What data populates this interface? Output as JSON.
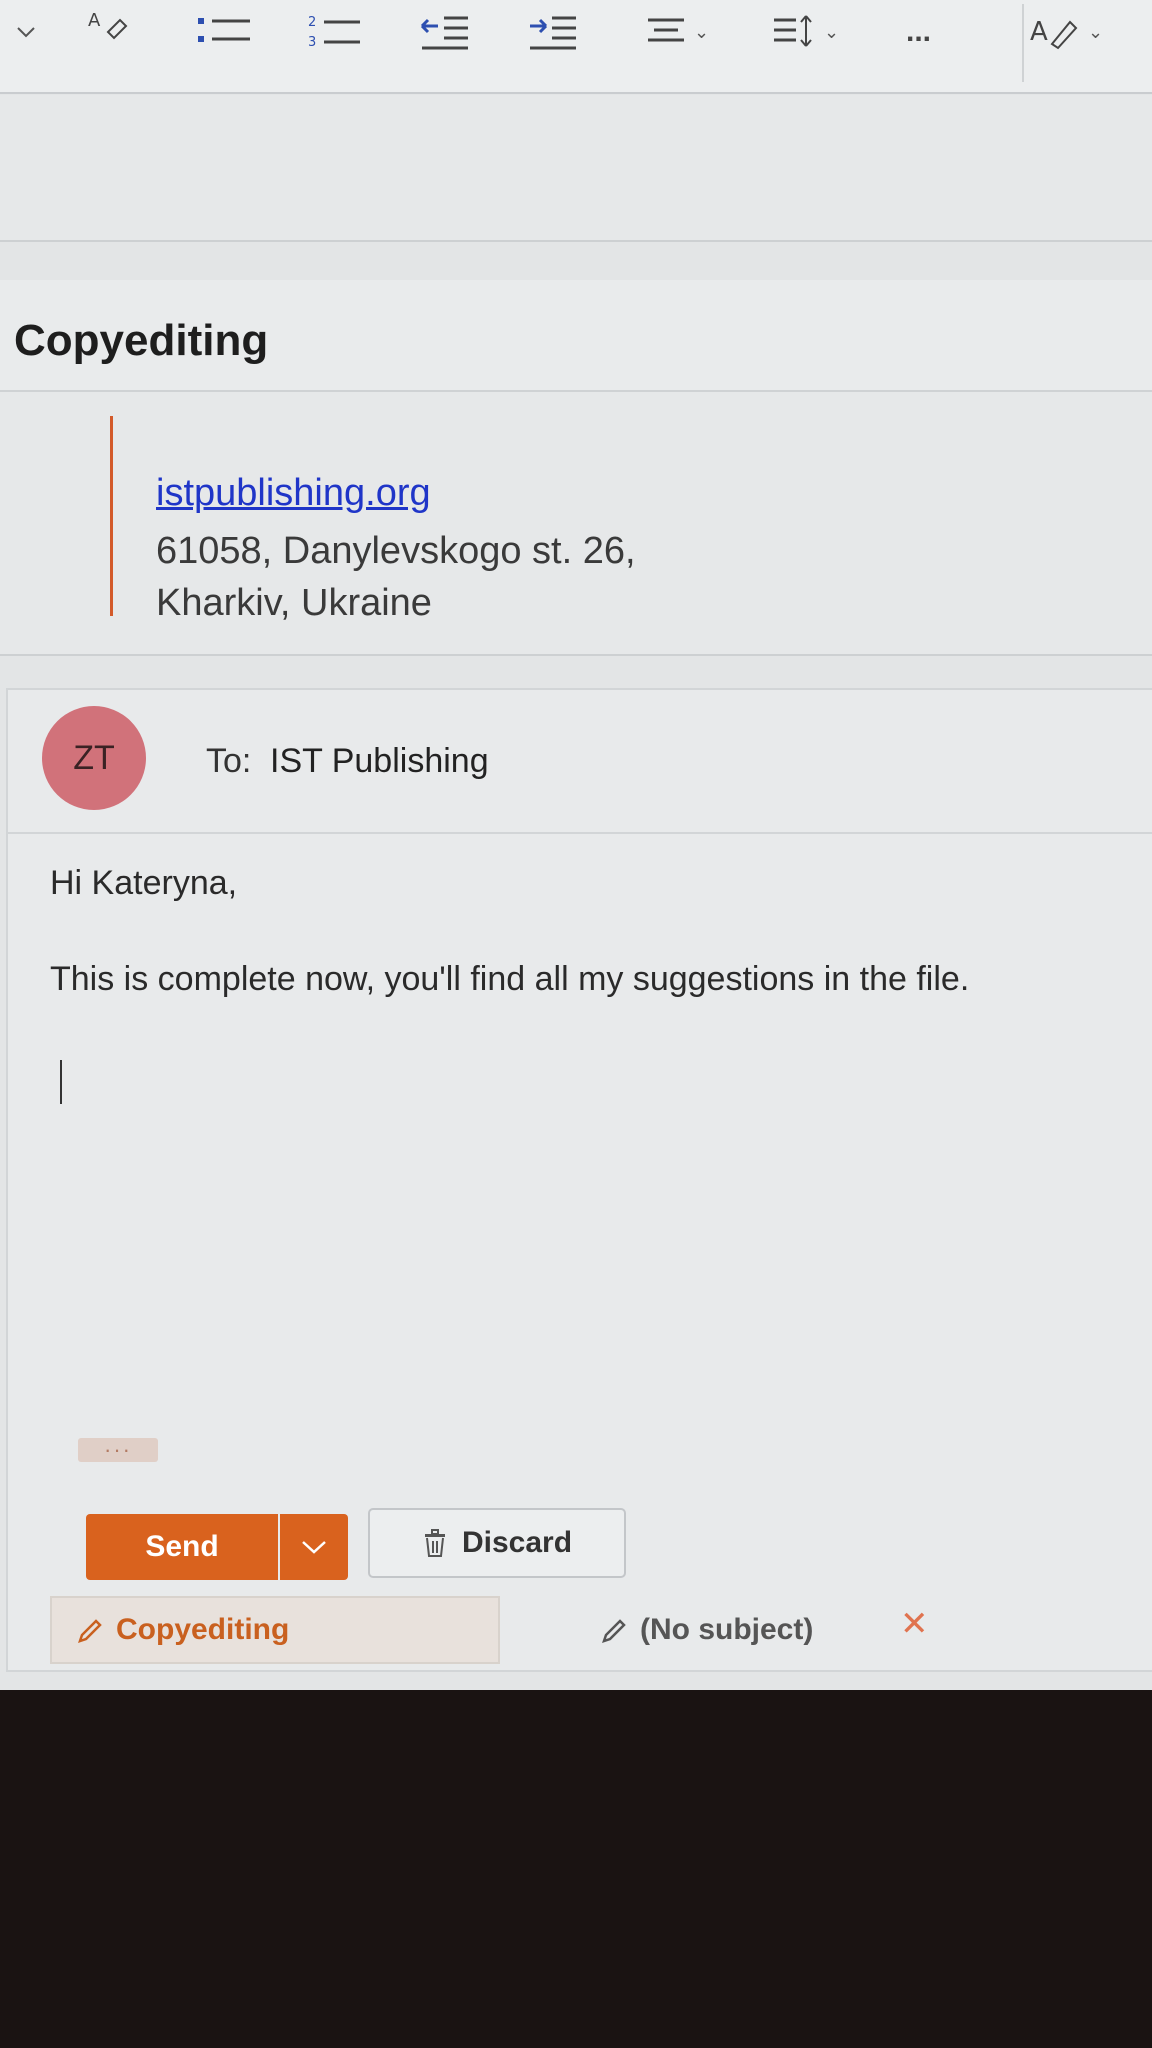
{
  "colors": {
    "accent": "#d9621e",
    "link": "#1f35c8",
    "avatar": "#d1727a"
  },
  "ribbon": {
    "icons": [
      "format-painter-icon",
      "bullet-list-icon",
      "numbered-list-icon",
      "decrease-indent-icon",
      "increase-indent-icon",
      "align-icon",
      "line-spacing-icon",
      "more-options-icon",
      "editor-icon"
    ],
    "more_label": "..."
  },
  "subject": {
    "title": "Copyediting"
  },
  "signature": {
    "link": "istpublishing.org",
    "address_line1": "61058, Danylevskogo st. 26,",
    "address_line2": "Kharkiv, Ukraine"
  },
  "message": {
    "avatar_initials": "ZT",
    "to_label": "To:",
    "to_value": "IST Publishing",
    "greeting": "Hi Kateryna,",
    "body": "This is complete now, you'll find all my suggestions in the file.",
    "more_dots": "···"
  },
  "actions": {
    "send_label": "Send",
    "discard_label": "Discard"
  },
  "draft_tabs": [
    {
      "label": "Copyediting",
      "active": true
    },
    {
      "label": "(No subject)",
      "active": false
    }
  ]
}
